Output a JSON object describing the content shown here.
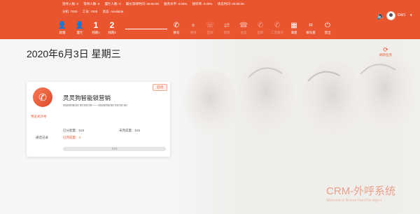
{
  "header": {
    "stats_row1": [
      "签呼入数: 0",
      "等待人数: 0",
      "置忙人数: 0",
      "最长等待时间: 00:00:00",
      "服务水平: 0.00%",
      "接听率: 0.00%",
      "状态时间: 00:00:36"
    ],
    "stats_row2": [
      "分机: 7000",
      "工号: 7000",
      "状态: Available"
    ],
    "toolbar": [
      {
        "icon": "user-icon",
        "glyph": "👤",
        "label": "就绪",
        "enabled": true
      },
      {
        "icon": "user-busy-icon",
        "glyph": "👤",
        "label": "置忙",
        "enabled": true
      },
      {
        "icon": "line-1-icon",
        "glyph": "1",
        "label": "线路1",
        "enabled": true
      },
      {
        "icon": "line-2-icon",
        "glyph": "2",
        "label": "线路2",
        "enabled": true
      },
      {
        "icon": "phone-icon",
        "glyph": "✆",
        "label": "拨号",
        "enabled": true
      },
      {
        "icon": "hold-icon",
        "glyph": "⏸",
        "label": "保持",
        "enabled": false
      },
      {
        "icon": "consult-icon",
        "glyph": "☏",
        "label": "咨询",
        "enabled": false
      },
      {
        "icon": "transfer-icon",
        "glyph": "⇄",
        "label": "转接",
        "enabled": false
      },
      {
        "icon": "conference-icon",
        "glyph": "☎",
        "label": "会议",
        "enabled": false
      },
      {
        "icon": "hangup-icon",
        "glyph": "✆",
        "label": "挂断",
        "enabled": false
      },
      {
        "icon": "secondary-dial-icon",
        "glyph": "✆",
        "label": "二次拨号",
        "enabled": false
      },
      {
        "icon": "survey-icon",
        "glyph": "▦",
        "label": "满意",
        "enabled": true
      },
      {
        "icon": "keypad-icon",
        "glyph": "⌗",
        "label": "拨号盘",
        "enabled": true
      },
      {
        "icon": "logout-icon",
        "glyph": "⏻",
        "label": "登出",
        "enabled": true
      }
    ],
    "user": {
      "name": "GW1"
    }
  },
  "main": {
    "date_title": "2020年6月3日 星期三",
    "refresh_label": "刷新任务",
    "brand_title": "CRM-外呼系统",
    "brand_subtitle": "Welcome to Bricom Plant For Agent"
  },
  "campaign_card": {
    "status_tag": "启动",
    "title": "灵灵狗智能锁营销",
    "date_range": "2020/05/22 00:00:00——2020/06/30 00:00:00",
    "type_label": "预览式外呼",
    "call_log_label": "通话记录",
    "assigned": "已分配量：519",
    "unfinished": "未完成量：515",
    "finished": "已完成量：4",
    "progress_text": "515",
    "progress_fraction": 0.0077
  },
  "colors": {
    "accent": "#e8552f",
    "card_bg": "#ffffff",
    "page_bg": "#f6f5f4"
  }
}
